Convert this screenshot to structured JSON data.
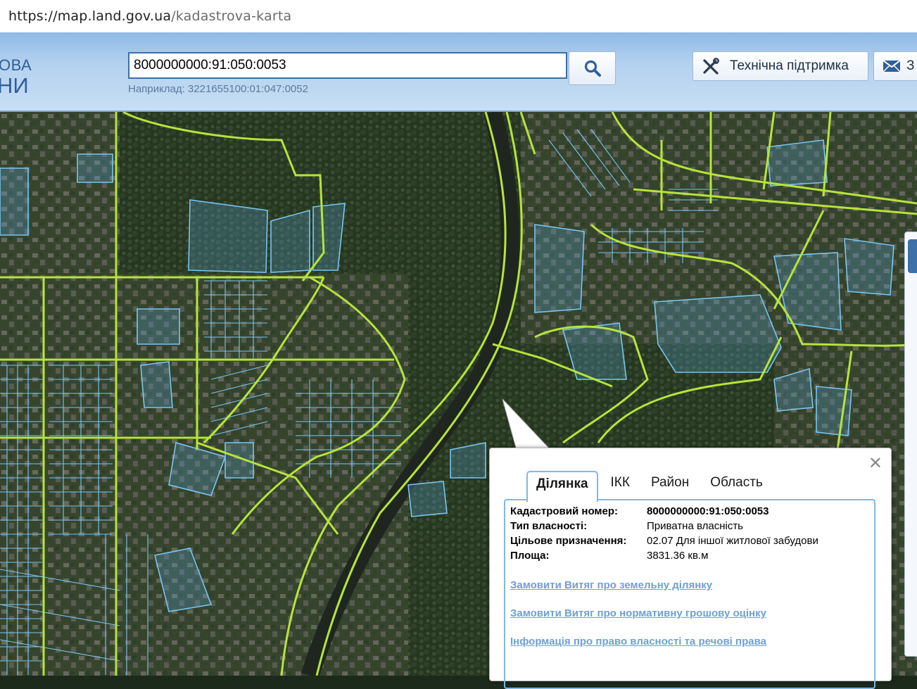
{
  "browser": {
    "url_host": "https://map.land.gov.ua",
    "url_path": "/kadastrova-karta"
  },
  "header": {
    "logo_line1": "ОВА",
    "logo_line2": "НИ",
    "search_value": "8000000000:91:050:0053",
    "search_hint": "Наприклад: 3221655100:01:047:0052",
    "support_label": "Технічна підтримка",
    "mail_label": "З"
  },
  "popup": {
    "tabs": [
      "Ділянка",
      "ІКК",
      "Район",
      "Область"
    ],
    "active_tab": "Ділянка",
    "fields": [
      {
        "label": "Кадастровий номер:",
        "value": "8000000000:91:050:0053"
      },
      {
        "label": "Тип власності:",
        "value": "Приватна власність"
      },
      {
        "label": "Цільове призначення:",
        "value": "02.07 Для іншої житлової забудови"
      },
      {
        "label": "Площа:",
        "value": "3831.36 кв.м"
      }
    ],
    "links": [
      "Замовити Витяг про земельну ділянку",
      "Замовити Витяг про нормативну грошову оцінку",
      "Інформація про право власності та речові права"
    ]
  },
  "colors": {
    "header_bg": "#b4d1ef",
    "map_bg": "#2c3b2a",
    "boundary_green": "#b6e43a",
    "parcel_blue": "#79c6f2",
    "link_color": "#6f9fd6"
  }
}
